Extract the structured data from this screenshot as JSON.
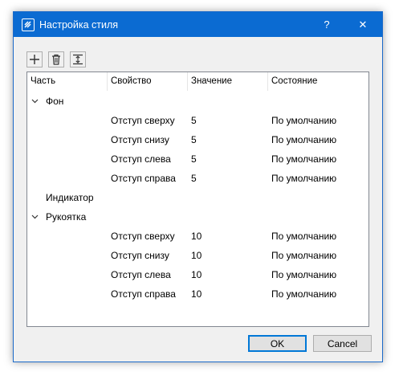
{
  "window": {
    "title": "Настройка стиля",
    "help_label": "?",
    "close_label": "✕"
  },
  "toolbar": {
    "buttons": [
      {
        "icon": "plus-icon"
      },
      {
        "icon": "trash-icon"
      },
      {
        "icon": "move-icon"
      }
    ]
  },
  "tree": {
    "columns": [
      "Часть",
      "Свойство",
      "Значение",
      "Состояние"
    ],
    "rows": [
      {
        "part": "Фон",
        "expanded": true,
        "property": "",
        "value": "",
        "state": ""
      },
      {
        "part": "",
        "property": "Отступ сверху",
        "value": "5",
        "state": "По умолчанию"
      },
      {
        "part": "",
        "property": "Отступ снизу",
        "value": "5",
        "state": "По умолчанию"
      },
      {
        "part": "",
        "property": "Отступ слева",
        "value": "5",
        "state": "По умолчанию"
      },
      {
        "part": "",
        "property": "Отступ справа",
        "value": "5",
        "state": "По умолчанию"
      },
      {
        "part": "Индикатор",
        "expanded": null,
        "property": "",
        "value": "",
        "state": ""
      },
      {
        "part": "Рукоятка",
        "expanded": true,
        "property": "",
        "value": "",
        "state": ""
      },
      {
        "part": "",
        "property": "Отступ сверху",
        "value": "10",
        "state": "По умолчанию"
      },
      {
        "part": "",
        "property": "Отступ снизу",
        "value": "10",
        "state": "По умолчанию"
      },
      {
        "part": "",
        "property": "Отступ слева",
        "value": "10",
        "state": "По умолчанию"
      },
      {
        "part": "",
        "property": "Отступ справа",
        "value": "10",
        "state": "По умолчанию"
      }
    ]
  },
  "buttons": {
    "ok_label": "OK",
    "cancel_label": "Cancel"
  },
  "colors": {
    "titlebar": "#0b6bd2",
    "default_button_border": "#0078d7"
  }
}
